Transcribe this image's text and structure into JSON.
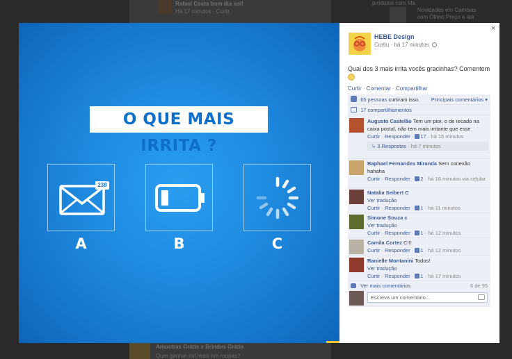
{
  "background": {
    "snippets": [
      {
        "text": "Rafael Costa bom dia sol!",
        "bold": true
      },
      {
        "text": "Há 17 minutos · Curtir",
        "bold": false
      },
      {
        "text": "produtos com Ma",
        "bold": false
      },
      {
        "text": "Novidades em Camisas",
        "bold": false
      },
      {
        "text": "com Ótimo Preço e até",
        "bold": false
      },
      {
        "text": "Amostras Grátis e Brindes Grátis",
        "bold": true
      },
      {
        "text": "Quer ganhar mil reais em roupas?",
        "bold": false
      }
    ]
  },
  "photo": {
    "headline": "O QUE MAIS IRRITA ?",
    "badge_count": "238",
    "options": [
      {
        "letter": "A",
        "icon": "envelope-icon"
      },
      {
        "letter": "B",
        "icon": "battery-low-icon"
      },
      {
        "letter": "C",
        "icon": "loading-spinner-icon"
      }
    ],
    "colors": {
      "bg": "#1f8be0",
      "headline_text": "#0d6fc9"
    }
  },
  "panel": {
    "close": "×",
    "page_name": "HEBE Design",
    "meta": "Curtiu · há 17 minutos",
    "post_text": "Qual dos 3 mais irrita vocês gracinhas? Comentem",
    "actions": {
      "like": "Curtir",
      "comment": "Comentar",
      "share": "Compartilhar"
    },
    "likes": {
      "count": "65 pessoas",
      "text": "curtiram isso.",
      "sort": "Principais comentários"
    },
    "shares": "17 compartilhamentos",
    "comments": [
      {
        "name": "Augusto Castelão",
        "text": "Tem um pior, o de recado na caixa postal, não tem mais irritante que esse",
        "reply": "Curtir",
        "respond": "Responder",
        "likes": "17",
        "time": "há 16 minutos",
        "replies": "3 Respostas",
        "replies_time": "há 7 minutos",
        "avatar_color": "#b5512e"
      },
      {
        "name": "Raphael Fernandes Miranda",
        "text": "Sem conexão hahaha",
        "reply": "Curtir",
        "respond": "Responder",
        "likes": "2",
        "time": "há 16 minutos via celular",
        "avatar_color": "#c8a36a"
      },
      {
        "name": "Natalia Seibert C",
        "text": "",
        "translate": "Ver tradução",
        "reply": "Curtir",
        "respond": "Responder",
        "likes": "1",
        "time": "há 11 minutos",
        "avatar_color": "#6b3f3a"
      },
      {
        "name": "Simone Souza c",
        "text": "",
        "translate": "Ver tradução",
        "reply": "Curtir",
        "respond": "Responder",
        "likes": "1",
        "time": "há 12 minutos",
        "avatar_color": "#5d6b2f"
      },
      {
        "name": "Camila Cortez",
        "text": "C!!!",
        "reply": "Curtir",
        "respond": "Responder",
        "likes": "1",
        "time": "há 12 minutos",
        "avatar_color": "#b9b2a4"
      },
      {
        "name": "Ranielle Montanini",
        "text": "Todos!",
        "translate": "Ver tradução",
        "reply": "Curtir",
        "respond": "Responder",
        "likes": "1",
        "time": "há 17 minutos",
        "avatar_color": "#8f3a2c"
      }
    ],
    "more_comments": "Ver mais comentários",
    "pagination": "6 de 95",
    "write_placeholder": "Escreva um comentário..."
  }
}
